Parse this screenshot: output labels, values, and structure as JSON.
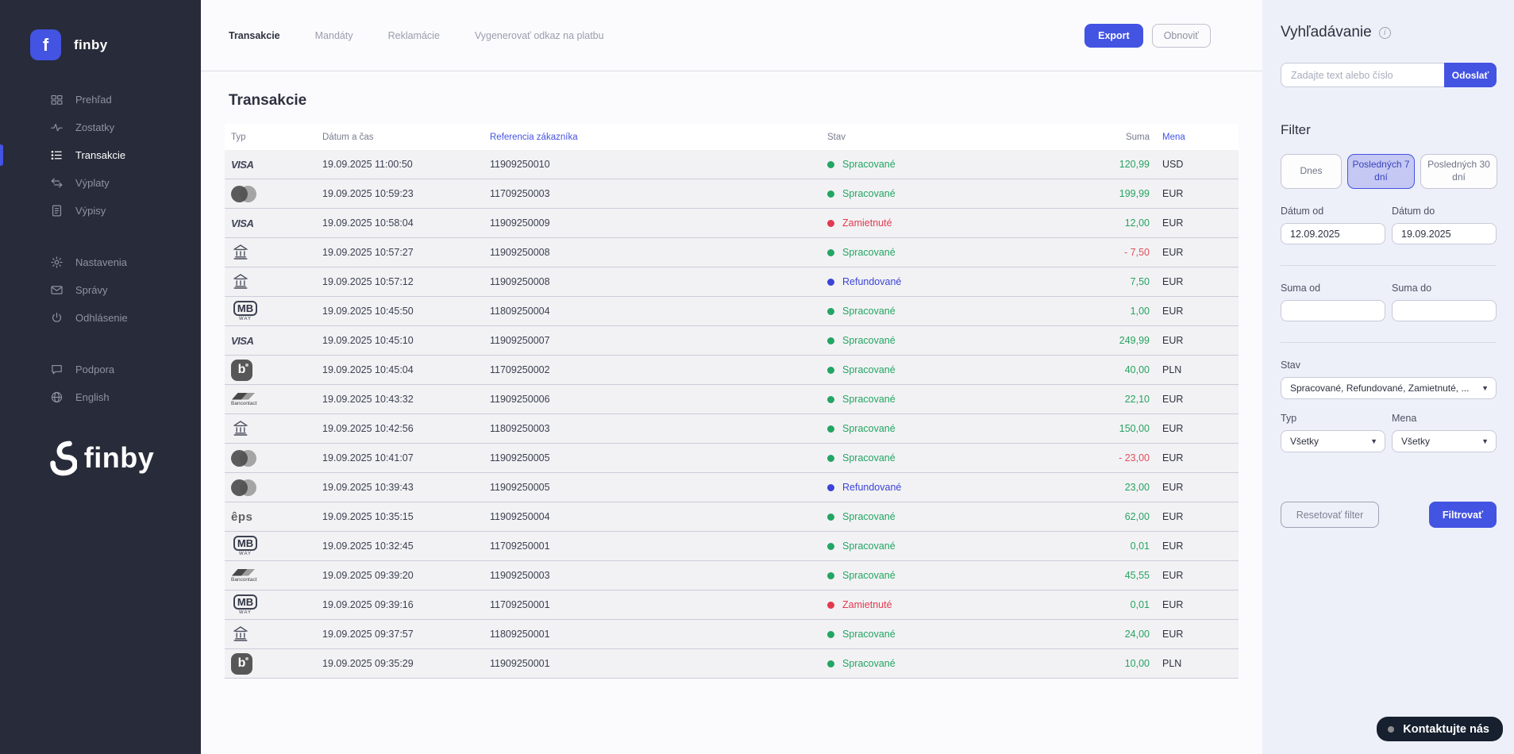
{
  "colors": {
    "accent": "#4353e2",
    "sidebar_bg": "#282b39",
    "panel_bg": "#eef0f9",
    "row_bg": "#f2f2f4",
    "status_processed": "#23a563",
    "status_rejected": "#e2394e",
    "status_refunded": "#3b43d8",
    "amount_positive": "#27a361",
    "amount_negative": "#e0505e",
    "contact_bg": "#16202f"
  },
  "sidebar": {
    "brand": {
      "logo_letter": "f",
      "name": "finby"
    },
    "groups": [
      [
        {
          "label": "Prehľad",
          "icon": "grid-icon"
        },
        {
          "label": "Zostatky",
          "icon": "activity-icon"
        },
        {
          "label": "Transakcie",
          "icon": "list-icon",
          "active": true
        },
        {
          "label": "Výplaty",
          "icon": "transfer-arrows-icon"
        },
        {
          "label": "Výpisy",
          "icon": "document-icon"
        }
      ],
      [
        {
          "label": "Nastavenia",
          "icon": "gear-icon"
        },
        {
          "label": "Správy",
          "icon": "mail-icon"
        },
        {
          "label": "Odhlásenie",
          "icon": "power-icon"
        }
      ],
      [
        {
          "label": "Podpora",
          "icon": "chat-icon"
        },
        {
          "label": "English",
          "icon": "globe-icon"
        }
      ]
    ],
    "footer_logo_text": "finby"
  },
  "topbar": {
    "tabs": [
      {
        "label": "Transakcie",
        "active": true
      },
      {
        "label": "Mandáty"
      },
      {
        "label": "Reklamácie"
      },
      {
        "label": "Vygenerovať odkaz na platbu"
      }
    ],
    "export_label": "Export",
    "refresh_label": "Obnoviť"
  },
  "page": {
    "title": "Transakcie"
  },
  "table": {
    "columns": [
      {
        "label": "Typ"
      },
      {
        "label": "Dátum a čas"
      },
      {
        "label": "Referencia zákazníka",
        "accent": true
      },
      {
        "label": "Stav"
      },
      {
        "label": "Suma",
        "align": "right"
      },
      {
        "label": "Mena",
        "accent": true
      }
    ],
    "statuses": {
      "processed": {
        "label": "Spracované",
        "color": "#23a563"
      },
      "rejected": {
        "label": "Zamietnuté",
        "color": "#e2394e"
      },
      "refunded": {
        "label": "Refundované",
        "color": "#3b43d8"
      }
    },
    "rows": [
      {
        "type": "visa",
        "datetime": "19.09.2025 11:00:50",
        "reference": "11909250010",
        "status": "processed",
        "amount": "120,99",
        "currency": "USD"
      },
      {
        "type": "mastercard",
        "datetime": "19.09.2025 10:59:23",
        "reference": "11709250003",
        "status": "processed",
        "amount": "199,99",
        "currency": "EUR"
      },
      {
        "type": "visa",
        "datetime": "19.09.2025 10:58:04",
        "reference": "11909250009",
        "status": "rejected",
        "amount": "12,00",
        "currency": "EUR"
      },
      {
        "type": "bank",
        "datetime": "19.09.2025 10:57:27",
        "reference": "11909250008",
        "status": "processed",
        "amount": "- 7,50",
        "currency": "EUR"
      },
      {
        "type": "bank",
        "datetime": "19.09.2025 10:57:12",
        "reference": "11909250008",
        "status": "refunded",
        "amount": "7,50",
        "currency": "EUR"
      },
      {
        "type": "mbway",
        "datetime": "19.09.2025 10:45:50",
        "reference": "11809250004",
        "status": "processed",
        "amount": "1,00",
        "currency": "EUR"
      },
      {
        "type": "visa",
        "datetime": "19.09.2025 10:45:10",
        "reference": "11909250007",
        "status": "processed",
        "amount": "249,99",
        "currency": "EUR"
      },
      {
        "type": "bancontact-app",
        "datetime": "19.09.2025 10:45:04",
        "reference": "11709250002",
        "status": "processed",
        "amount": "40,00",
        "currency": "PLN"
      },
      {
        "type": "bancontact",
        "datetime": "19.09.2025 10:43:32",
        "reference": "11909250006",
        "status": "processed",
        "amount": "22,10",
        "currency": "EUR"
      },
      {
        "type": "bank",
        "datetime": "19.09.2025 10:42:56",
        "reference": "11809250003",
        "status": "processed",
        "amount": "150,00",
        "currency": "EUR"
      },
      {
        "type": "mastercard",
        "datetime": "19.09.2025 10:41:07",
        "reference": "11909250005",
        "status": "processed",
        "amount": "- 23,00",
        "currency": "EUR"
      },
      {
        "type": "mastercard",
        "datetime": "19.09.2025 10:39:43",
        "reference": "11909250005",
        "status": "refunded",
        "amount": "23,00",
        "currency": "EUR"
      },
      {
        "type": "eps",
        "datetime": "19.09.2025 10:35:15",
        "reference": "11909250004",
        "status": "processed",
        "amount": "62,00",
        "currency": "EUR"
      },
      {
        "type": "mbway",
        "datetime": "19.09.2025 10:32:45",
        "reference": "11709250001",
        "status": "processed",
        "amount": "0,01",
        "currency": "EUR"
      },
      {
        "type": "bancontact",
        "datetime": "19.09.2025 09:39:20",
        "reference": "11909250003",
        "status": "processed",
        "amount": "45,55",
        "currency": "EUR"
      },
      {
        "type": "mbway",
        "datetime": "19.09.2025 09:39:16",
        "reference": "11709250001",
        "status": "rejected",
        "amount": "0,01",
        "currency": "EUR"
      },
      {
        "type": "bank",
        "datetime": "19.09.2025 09:37:57",
        "reference": "11809250001",
        "status": "processed",
        "amount": "24,00",
        "currency": "EUR"
      },
      {
        "type": "bancontact-app",
        "datetime": "19.09.2025 09:35:29",
        "reference": "11909250001",
        "status": "processed",
        "amount": "10,00",
        "currency": "PLN"
      }
    ]
  },
  "search": {
    "title": "Vyhľadávanie",
    "placeholder": "Zadajte text alebo číslo",
    "submit_label": "Odoslať"
  },
  "filter": {
    "title": "Filter",
    "quick": [
      {
        "label": "Dnes"
      },
      {
        "label": "Posledných 7 dní",
        "active": true
      },
      {
        "label": "Posledných 30 dní"
      }
    ],
    "date_from_label": "Dátum od",
    "date_to_label": "Dátum do",
    "date_from": "12.09.2025",
    "date_to": "19.09.2025",
    "amount_from_label": "Suma od",
    "amount_to_label": "Suma do",
    "amount_from": "",
    "amount_to": "",
    "status_label": "Stav",
    "status_value": "Spracované, Refundované, Zamietnuté, ...",
    "type_label": "Typ",
    "type_value": "Všetky",
    "currency_label": "Mena",
    "currency_value": "Všetky",
    "reset_label": "Resetovať filter",
    "apply_label": "Filtrovať"
  },
  "contact": {
    "label": "Kontaktujte nás"
  }
}
